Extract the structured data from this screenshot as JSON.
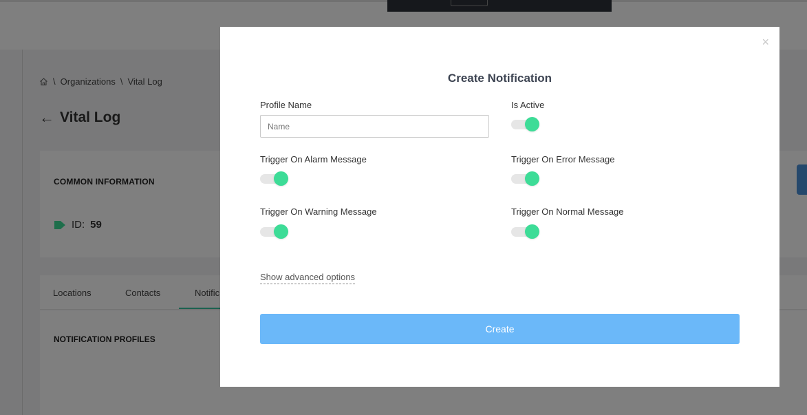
{
  "background": {
    "breadcrumb": {
      "separator": "\\",
      "items": [
        "Organizations",
        "Vital Log"
      ]
    },
    "page_title": "Vital Log",
    "common_information": {
      "heading": "COMMON INFORMATION",
      "id_label": "ID:",
      "id_value": "59"
    },
    "tabs": [
      "Locations",
      "Contacts",
      "Notific"
    ],
    "notification_profiles_heading": "NOTIFICATION PROFILES"
  },
  "modal": {
    "close_symbol": "×",
    "title": "Create Notification",
    "profile_name": {
      "label": "Profile Name",
      "placeholder": "Name",
      "value": ""
    },
    "toggles": [
      {
        "label": "Is Active",
        "on": true
      },
      {
        "label": "Trigger On Alarm Message",
        "on": true
      },
      {
        "label": "Trigger On Error Message",
        "on": true
      },
      {
        "label": "Trigger On Warning Message",
        "on": true
      },
      {
        "label": "Trigger On Normal Message",
        "on": true
      }
    ],
    "advanced_link": "Show advanced options",
    "create_button": "Create"
  },
  "colors": {
    "toggle_knob": "#3ddc97",
    "create_button": "#6bb8f9",
    "tab_underline": "#36c4a0",
    "tag_icon": "#3ddc97"
  },
  "icons": [
    "home-icon",
    "back-arrow-icon",
    "tag-icon",
    "close-icon"
  ]
}
